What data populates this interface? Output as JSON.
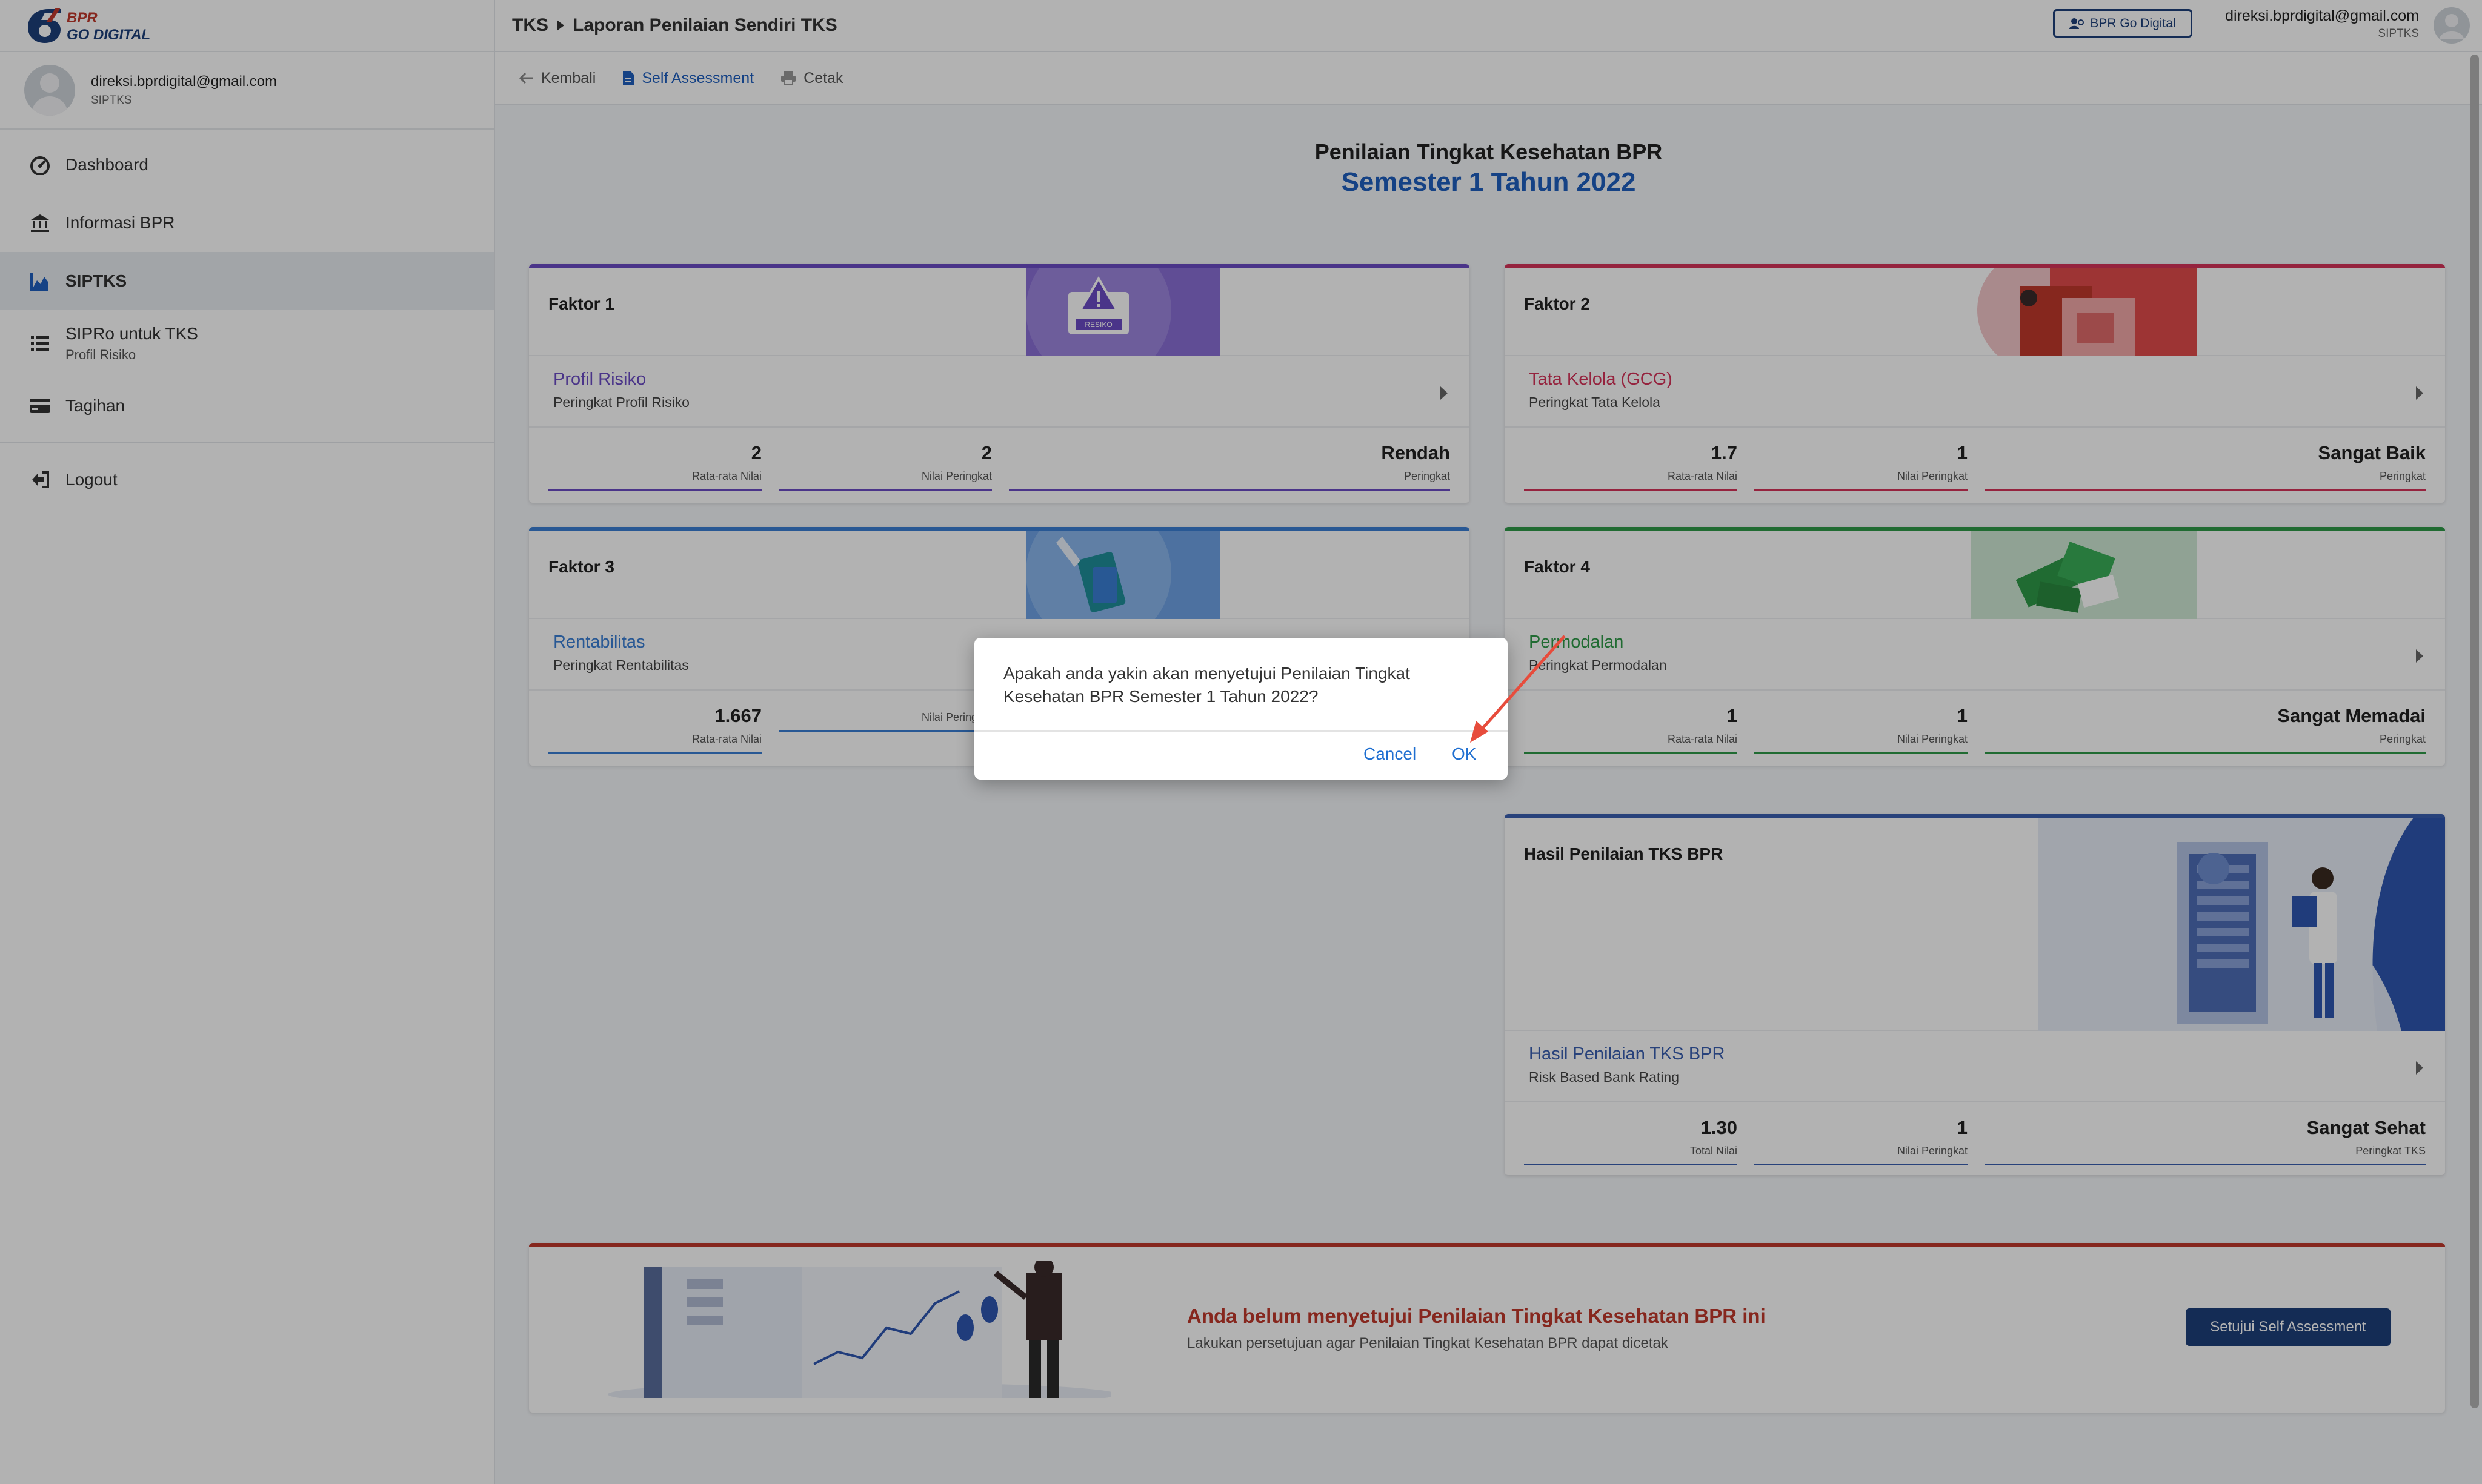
{
  "app": {
    "logo_text_1": "BPR",
    "logo_text_2": "GO DIGITAL"
  },
  "sidebar": {
    "user": {
      "email": "direksi.bprdigital@gmail.com",
      "role": "SIPTKS"
    },
    "items": [
      {
        "label": "Dashboard",
        "icon": "dashboard-icon"
      },
      {
        "label": "Informasi BPR",
        "icon": "bank-icon"
      },
      {
        "label": "SIPTKS",
        "icon": "chart-icon"
      },
      {
        "label": "SIPRo untuk TKS",
        "sub": "Profil Risiko",
        "icon": "list-icon"
      },
      {
        "label": "Tagihan",
        "icon": "card-icon"
      }
    ],
    "logout": "Logout"
  },
  "header": {
    "crumb_1": "TKS",
    "crumb_2": "Laporan Penilaian Sendiri TKS",
    "brand_button": "BPR Go Digital",
    "user_email": "direksi.bprdigital@gmail.com",
    "user_role": "SIPTKS"
  },
  "toolbar": {
    "back": "Kembali",
    "self_assessment": "Self Assessment",
    "print": "Cetak"
  },
  "page": {
    "title": "Penilaian Tingkat Kesehatan BPR",
    "subtitle": "Semester 1 Tahun 2022"
  },
  "factors": [
    {
      "title": "Faktor 1",
      "name": "Profil Risiko",
      "sub": "Peringkat Profil Risiko",
      "color": "#6a4bc4",
      "stats": [
        {
          "value": "2",
          "label": "Rata-rata Nilai"
        },
        {
          "value": "2",
          "label": "Nilai Peringkat"
        },
        {
          "value": "Rendah",
          "label": "Peringkat"
        }
      ],
      "illus_text": "RESIKO"
    },
    {
      "title": "Faktor 2",
      "name": "Tata Kelola (GCG)",
      "sub": "Peringkat Tata Kelola",
      "color": "#d6335a",
      "stats": [
        {
          "value": "1.7",
          "label": "Rata-rata Nilai"
        },
        {
          "value": "1",
          "label": "Nilai Peringkat"
        },
        {
          "value": "Sangat Baik",
          "label": "Peringkat"
        }
      ]
    },
    {
      "title": "Faktor 3",
      "name": "Rentabilitas",
      "sub": "Peringkat Rentabilitas",
      "color": "#3a7fd5",
      "stats": [
        {
          "value": "1.667",
          "label": "Rata-rata Nilai"
        },
        {
          "value": "",
          "label": "Nilai Peringkat"
        }
      ]
    },
    {
      "title": "Faktor 4",
      "name": "Permodalan",
      "sub": "Peringkat Permodalan",
      "color": "#2f9a48",
      "stats": [
        {
          "value": "1",
          "label": "Rata-rata Nilai"
        },
        {
          "value": "1",
          "label": "Nilai Peringkat"
        },
        {
          "value": "Sangat Memadai",
          "label": "Peringkat"
        }
      ]
    }
  ],
  "result": {
    "title": "Hasil Penilaian TKS BPR",
    "name": "Hasil Penilaian TKS BPR",
    "sub": "Risk Based Bank Rating",
    "color": "#3a5fb0",
    "stats": [
      {
        "value": "1.30",
        "label": "Total Nilai"
      },
      {
        "value": "1",
        "label": "Nilai Peringkat"
      },
      {
        "value": "Sangat Sehat",
        "label": "Peringkat TKS"
      }
    ]
  },
  "banner": {
    "title": "Anda belum menyetujui Penilaian Tingkat Kesehatan BPR ini",
    "sub": "Lakukan persetujuan agar Penilaian Tingkat Kesehatan BPR dapat dicetak",
    "button": "Setujui Self Assessment"
  },
  "dialog": {
    "message": "Apakah anda yakin akan menyetujui Penilaian Tingkat Kesehatan BPR Semester 1 Tahun 2022?",
    "cancel": "Cancel",
    "ok": "OK"
  },
  "annotation": {
    "arrow_color": "#e74c3c"
  }
}
